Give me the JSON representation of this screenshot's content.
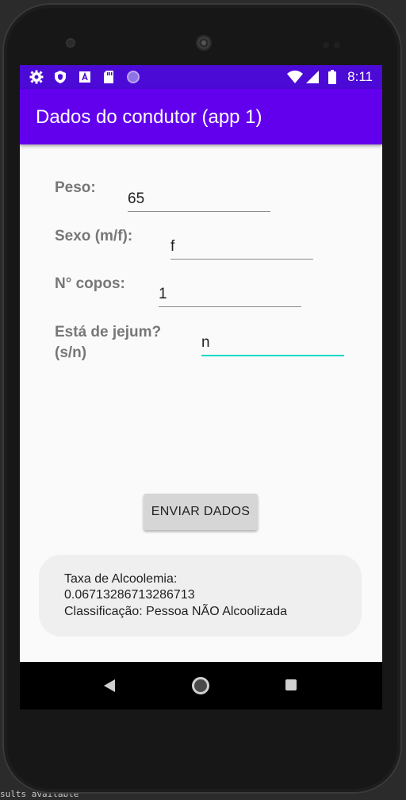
{
  "ide": {
    "bottom_fragment": "sults available"
  },
  "status_bar": {
    "time": "8:11",
    "left_icons": [
      "settings-icon",
      "shield-icon",
      "a-icon",
      "sd-card-icon",
      "circle-icon"
    ],
    "right_icons": [
      "wifi-icon",
      "signal-icon",
      "battery-icon"
    ],
    "background": "#4c0ad6"
  },
  "app_bar": {
    "title": "Dados do condutor (app 1)",
    "background": "#6200ee"
  },
  "form": {
    "peso_label": "Peso:",
    "peso_value": "65",
    "sexo_label": "Sexo (m/f):",
    "sexo_value": "f",
    "copos_label": "N° copos:",
    "copos_value": "1",
    "jejum_label_line1": "Está de jejum?",
    "jejum_label_line2": "(s/n)",
    "jejum_value": "n"
  },
  "actions": {
    "submit_label": "ENVIAR DADOS"
  },
  "result": {
    "line1": "Taxa de Alcoolemia:",
    "line2": "0.06713286713286713",
    "line3": "Classificação: Pessoa NÃO Alcoolizada"
  },
  "colors": {
    "accent_focus": "#03dac5",
    "label_gray": "#777777"
  }
}
